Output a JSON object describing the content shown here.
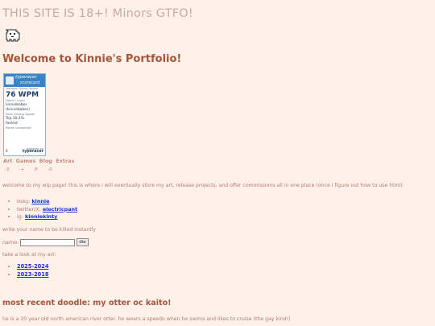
{
  "header": {
    "warning": "THIS SITE IS 18+! Minors GTFO!",
    "welcome": "Welcome to Kinnie's Portfolio!"
  },
  "icons": {
    "ghost": "ghost-pixel-icon",
    "keyboard": "keyboard-icon"
  },
  "badge": {
    "brand_top": "typeracer",
    "brand_bottom": "scorecard",
    "avg_label": "Average Typing Speed",
    "wpm": "76 WPM",
    "name_label": "Name / Login",
    "name": "kinniebabes",
    "login": "(kinniebabes)",
    "rank_label": "Rank Among Typists",
    "rank": "Top 10.3%",
    "rank2": "fastest",
    "races_label": "Races Completed",
    "races": "6",
    "powered": "powered by",
    "powered_brand": "typeracer"
  },
  "nav": [
    "Art",
    "Games",
    "Blog",
    "Extras"
  ],
  "emotes": [
    ":3",
    ":+",
    ":P",
    ":0"
  ],
  "intro": "welcome to my wip page! this is where i will eventually store my art, release projects, and offer commissions all in one place (once i figure out how to use html)",
  "socials": [
    {
      "label": "bsky:",
      "handle": "kinnie"
    },
    {
      "label": "twitter/X:",
      "handle": "electricpant"
    },
    {
      "label": "ig:",
      "handle": "kinniekinty"
    }
  ],
  "kill_prompt": "write your name to be killed instantly",
  "name_form": {
    "label": "name:",
    "value": "",
    "button": "die"
  },
  "art_prompt": "take a look at my art:",
  "art_links": [
    "2025-2024",
    "2023-2018"
  ],
  "doodle_title": "most recent doodle: my otter oc kaito!",
  "doodle_desc": "he is a 20 year old north american river otter. he wears a speedo when he swims and likes to cruise (the gay kind!)"
}
